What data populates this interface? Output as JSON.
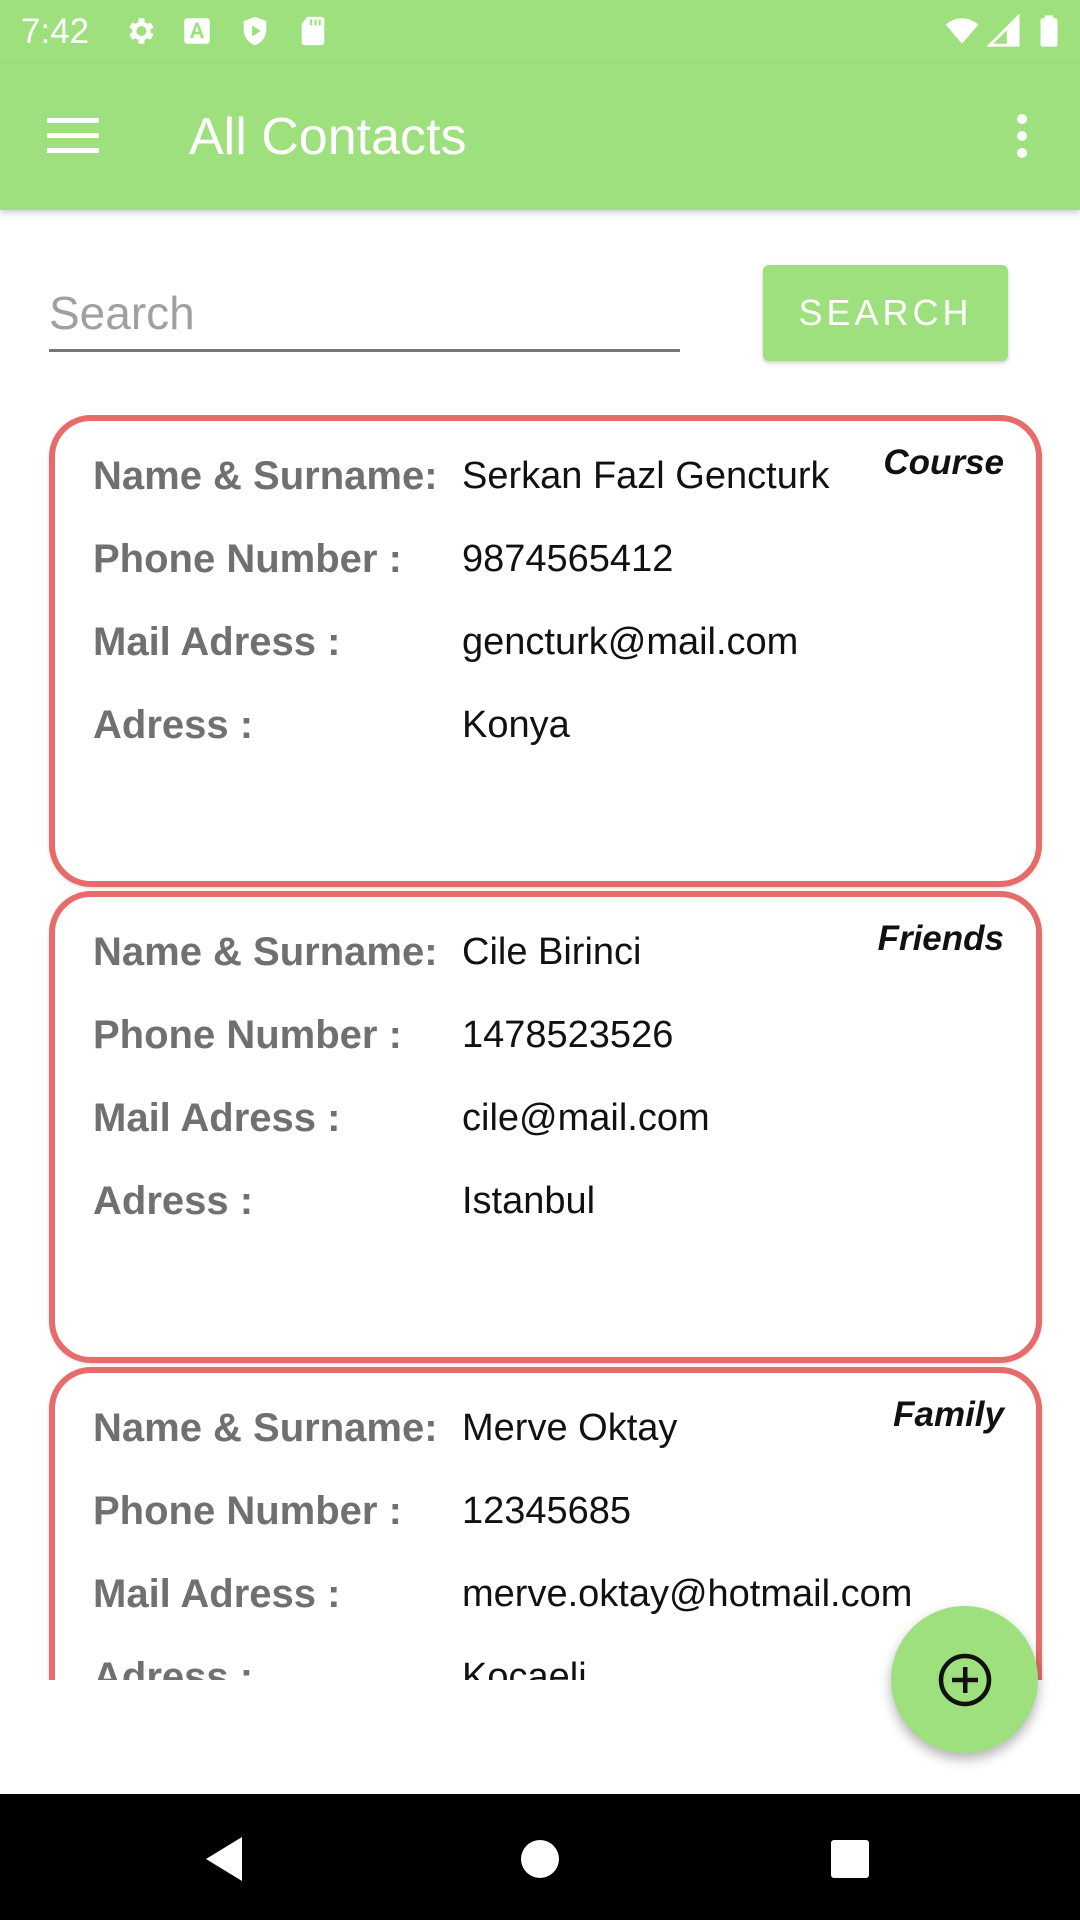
{
  "status_bar": {
    "time": "7:42",
    "left_icons": [
      "settings-icon",
      "text-a-icon",
      "shield-play-icon",
      "sd-card-icon"
    ],
    "right_icons": [
      "wifi-icon",
      "signal-icon",
      "battery-icon"
    ]
  },
  "app_bar": {
    "title": "All Contacts",
    "menu_icon": "hamburger-menu-icon",
    "overflow_icon": "more-vert-icon"
  },
  "search": {
    "placeholder": "Search",
    "value": "",
    "button_label": "SEARCH"
  },
  "labels": {
    "name": "Name & Surname:",
    "phone": "Phone Number :",
    "mail": "Mail Adress :",
    "address": "Adress :"
  },
  "contacts": [
    {
      "name": "Serkan Fazl Gencturk",
      "phone": "9874565412",
      "mail": "gencturk@mail.com",
      "address": "Konya",
      "category": "Course"
    },
    {
      "name": "Cile Birinci",
      "phone": "1478523526",
      "mail": "cile@mail.com",
      "address": "Istanbul",
      "category": "Friends"
    },
    {
      "name": "Merve Oktay",
      "phone": "12345685",
      "mail": "merve.oktay@hotmail.com",
      "address": "Kocaeli",
      "category": "Family"
    }
  ],
  "fab": {
    "icon": "add-circle-icon"
  },
  "colors": {
    "primary": "#9ee07d",
    "card_border": "#e66b6b",
    "label_gray": "#707070"
  }
}
